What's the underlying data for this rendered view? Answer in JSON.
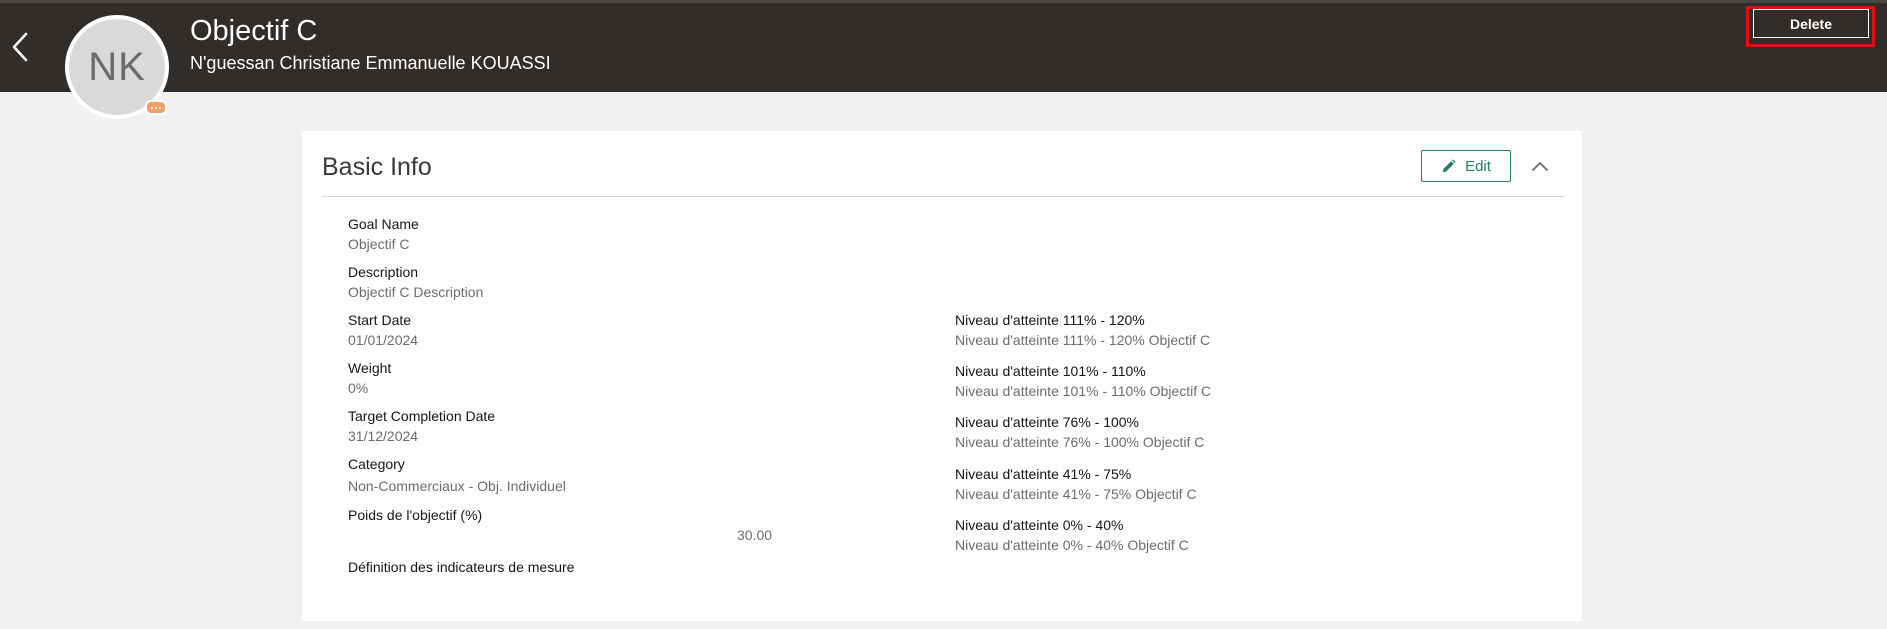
{
  "header": {
    "title": "Objectif C",
    "subtitle": "N'guessan Christiane Emmanuelle KOUASSI",
    "avatar_initials": "NK",
    "delete_label": "Delete",
    "back_icon": "chevron-left-icon"
  },
  "basic_info": {
    "title": "Basic Info",
    "edit_label": "Edit",
    "edit_icon": "pencil-icon",
    "collapse_icon": "chevron-up-icon",
    "left_fields": [
      {
        "label": "Goal Name",
        "value": "Objectif C"
      },
      {
        "label": "Description",
        "value": "Objectif C Description"
      },
      {
        "label": "Start Date",
        "value": "01/01/2024"
      },
      {
        "label": "Weight",
        "value": "0%"
      },
      {
        "label": "Target Completion Date",
        "value": "31/12/2024"
      },
      {
        "label": "Category",
        "value": "Non-Commerciaux - Obj. Individuel"
      },
      {
        "label": "Poids de l'objectif (%)",
        "value": "30.00"
      },
      {
        "label": "Définition des indicateurs de mesure",
        "value": ""
      }
    ],
    "right_fields": [
      {
        "label": "Niveau d'atteinte 111% - 120%",
        "value": "Niveau d'atteinte 111% - 120% Objectif C"
      },
      {
        "label": "Niveau d'atteinte 101% - 110%",
        "value": "Niveau d'atteinte 101% - 110% Objectif C"
      },
      {
        "label": "Niveau d'atteinte 76% - 100%",
        "value": "Niveau d'atteinte 76% - 100% Objectif C"
      },
      {
        "label": "Niveau d'atteinte 41% - 75%",
        "value": "Niveau d'atteinte 41% - 75% Objectif C"
      },
      {
        "label": "Niveau d'atteinte 0% - 40%",
        "value": "Niveau d'atteinte 0% - 40% Objectif C"
      }
    ]
  },
  "colors": {
    "header_bg": "#312d2a",
    "accent": "#227e6e",
    "highlight": "#e01010",
    "page_bg": "#f1f1f1"
  }
}
